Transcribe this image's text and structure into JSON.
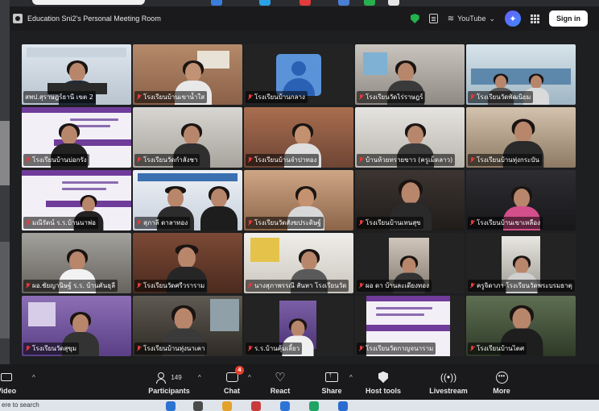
{
  "window": {
    "title": "Education Sni2's Personal Meeting Room",
    "livestream_label": "YouTube",
    "signin_label": "Sign in"
  },
  "taskbar": {
    "search_placeholder": "ere to search"
  },
  "participants": [
    {
      "name": "สพป.สุราษฎร์ธานี เขต 2",
      "muted": false,
      "active": true
    },
    {
      "name": "โรงเรียนบ้านเขาน้ำใส",
      "muted": true
    },
    {
      "name": "โรงเรียนบ้านกลาง",
      "muted": true
    },
    {
      "name": "โรงเรียนวัดไร่ราษฎร์",
      "muted": true
    },
    {
      "name": "โรงเรียนวัดพัฒนิยม",
      "muted": true
    },
    {
      "name": "โรงเรียนบ้านบ่อกรัง",
      "muted": true
    },
    {
      "name": "โรงเรียนวัดกำลังชา",
      "muted": true
    },
    {
      "name": "โรงเรียนบ้านจำปาทอง",
      "muted": true
    },
    {
      "name": "บ้านห้วยทรายขาว (ครูเม็ดลาว)",
      "muted": true
    },
    {
      "name": "โรงเรียนบ้านทุ่งกระบัน",
      "muted": true
    },
    {
      "name": "มณีรัตน์ ร.ร.บ้านนาพ่อ",
      "muted": true
    },
    {
      "name": "สุภาลี ดาลาทอง",
      "muted": true
    },
    {
      "name": "โรงเรียนวัดสังฆประดิษฐ์",
      "muted": true
    },
    {
      "name": "โรงเรียนบ้านเทนสุข",
      "muted": true
    },
    {
      "name": "โรงเรียนบ้านเขาเหลือง",
      "muted": true
    },
    {
      "name": "ผอ.ชัยญานิษฐ์ ร.ร. บ้านคันธุลี",
      "muted": true
    },
    {
      "name": "โรงเรียนวัดศรีวราราม",
      "muted": true
    },
    {
      "name": "นางสุภาพรรณี สันหา โรงเรียนวัด",
      "muted": true
    },
    {
      "name": "ผอ ดา บ้านละเดียงทอง",
      "muted": true
    },
    {
      "name": "ครูจิดาภา โรงเรียนวัดพระบรมธาตุ",
      "muted": true
    },
    {
      "name": "โรงเรียนวัดสุขุม",
      "muted": true
    },
    {
      "name": "โรงเรียนบ้านทุ่งนาเคา",
      "muted": true
    },
    {
      "name": "ร.ร.บ้านคุ้มเลี้ยว",
      "muted": true
    },
    {
      "name": "โรงเรียนวัดกาญจนาราม",
      "muted": true
    },
    {
      "name": "โรงเรียนบ้านไตศ",
      "muted": true
    }
  ],
  "toolbar": {
    "video_label": "Video",
    "participants_label": "Participants",
    "participants_count": "149",
    "chat_label": "Chat",
    "chat_badge": "4",
    "react_label": "React",
    "share_label": "Share",
    "host_tools_label": "Host tools",
    "livestream_label": "Livestream",
    "more_label": "More"
  }
}
